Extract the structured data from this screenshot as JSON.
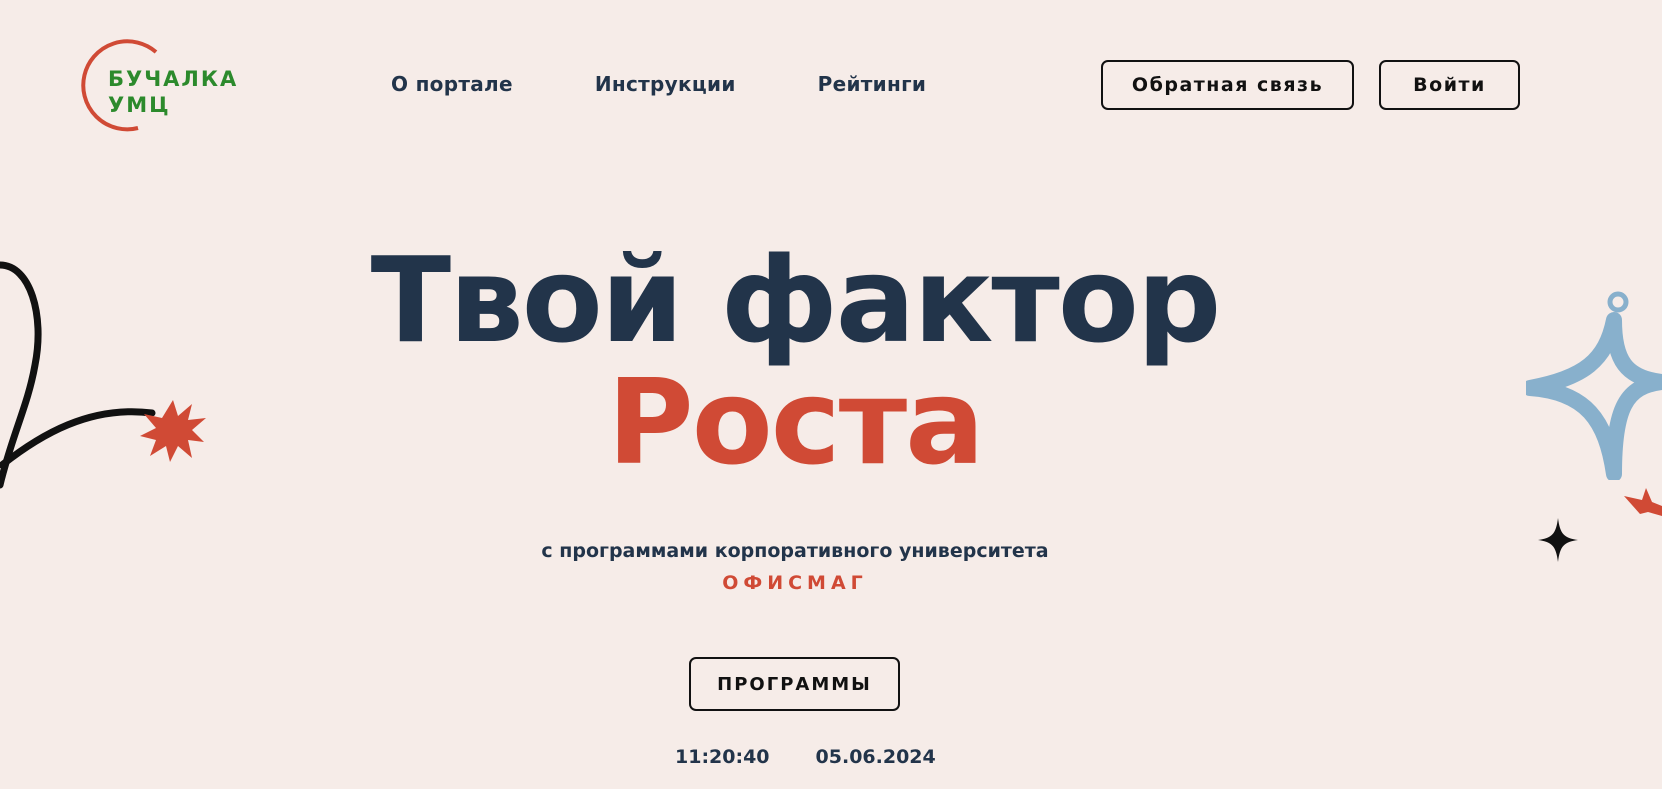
{
  "logo": {
    "line1": "БУЧАЛКА",
    "line2": "УМЦ"
  },
  "nav": {
    "items": [
      {
        "label": "О портале"
      },
      {
        "label": "Инструкции"
      },
      {
        "label": "Рейтинги"
      }
    ]
  },
  "header": {
    "feedback_label": "Обратная связь",
    "login_label": "Войти"
  },
  "hero": {
    "title_line1": "Твой фактор",
    "title_line2": "Роста",
    "subtitle": "с программами корпоративного университета",
    "brand": "ОФИСМАГ",
    "programs_label": "ПРОГРАММЫ"
  },
  "status": {
    "time": "11:20:40",
    "date": "05.06.2024"
  },
  "colors": {
    "background": "#f6ece8",
    "navy": "#22344a",
    "accent_red": "#d04a35",
    "logo_green": "#2c8a2c",
    "deco_blue": "#88b0cc"
  }
}
